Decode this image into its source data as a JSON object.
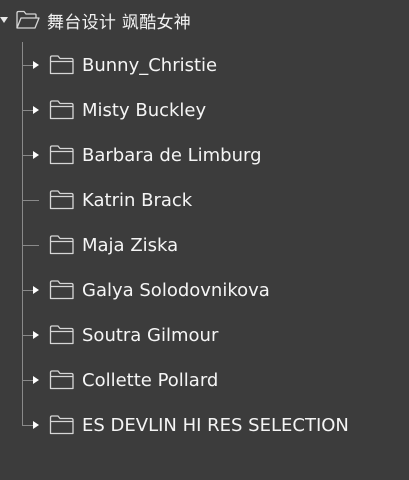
{
  "root": {
    "label": "舞台设计 飒酷女神",
    "icon": "folder-open-icon",
    "expanded": true
  },
  "children": [
    {
      "label": "Bunny_Christie",
      "icon": "folder-icon",
      "has_children": true
    },
    {
      "label": "Misty Buckley",
      "icon": "folder-icon",
      "has_children": true
    },
    {
      "label": "Barbara de Limburg",
      "icon": "folder-icon",
      "has_children": true
    },
    {
      "label": "Katrin Brack",
      "icon": "folder-icon",
      "has_children": false
    },
    {
      "label": "Maja Ziska",
      "icon": "folder-icon",
      "has_children": false
    },
    {
      "label": "Galya Solodovnikova",
      "icon": "folder-icon",
      "has_children": true
    },
    {
      "label": "Soutra Gilmour",
      "icon": "folder-icon",
      "has_children": true
    },
    {
      "label": "Collette Pollard",
      "icon": "folder-icon",
      "has_children": true
    },
    {
      "label": "ES DEVLIN HI RES SELECTION",
      "icon": "folder-icon",
      "has_children": true
    }
  ],
  "colors": {
    "background": "#3c3c3c",
    "text": "#f5f5f5",
    "tree_line": "#8a8a8a"
  }
}
